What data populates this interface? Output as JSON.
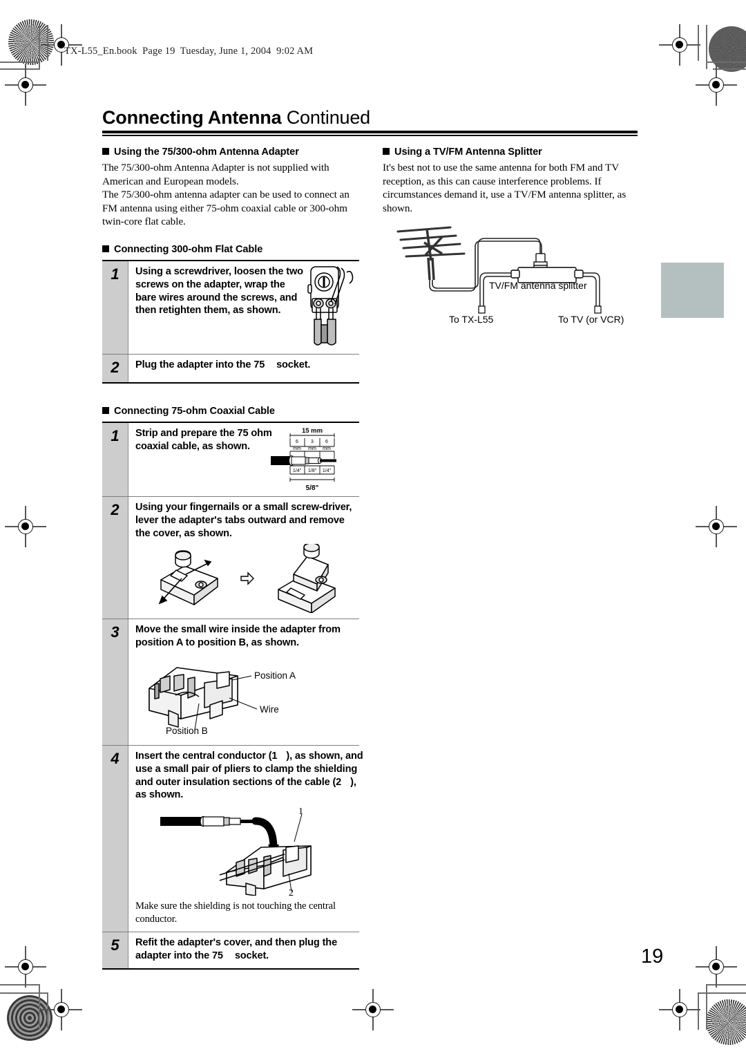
{
  "header": {
    "book_line": "TX-L55_En.book  Page 19  Tuesday, June 1, 2004  9:02 AM"
  },
  "title": {
    "main": "Connecting Antenna",
    "continued": "Continued"
  },
  "page_number": "19",
  "left_column": {
    "section1": {
      "heading": "Using the 75/300-ohm Antenna Adapter",
      "paragraphs": [
        "The 75/300-ohm Antenna Adapter is not supplied with American and European models.",
        "The 75/300-ohm antenna adapter can be used to connect an FM antenna using either 75-ohm coaxial cable or 300-ohm twin-core flat cable."
      ]
    },
    "section2": {
      "heading": "Connecting 300-ohm Flat Cable",
      "steps": [
        {
          "number": "1",
          "text": "Using a screwdriver, loosen the two screws on the adapter, wrap the bare wires around the screws, and then retighten them, as shown.",
          "figure": "adapter-screws-screwdriver-illustration"
        },
        {
          "number": "2",
          "text_before": "Plug the adapter into the 75",
          "text_after": "socket.",
          "figure": null
        }
      ]
    },
    "section3": {
      "heading": "Connecting 75-ohm Coaxial Cable",
      "steps": [
        {
          "number": "1",
          "text": "Strip and prepare the 75 ohm coaxial cable, as shown.",
          "figure": "coaxial-cable-dimensions-illustration",
          "figure_labels": {
            "total_mm": "15 mm",
            "seg1_val": "6",
            "seg1_unit": "mm",
            "seg2_val": "3",
            "seg2_unit": "mm",
            "seg3_val": "6",
            "seg3_unit": "mm",
            "seg1_in": "1/4\"",
            "seg2_in": "1/8\"",
            "seg3_in": "1/4\"",
            "total_in": "5/8\""
          }
        },
        {
          "number": "2",
          "text": "Using your fingernails or a small screw-driver, lever the adapter's tabs outward and remove the cover, as shown.",
          "figure": "adapter-cover-removal-illustration"
        },
        {
          "number": "3",
          "text": "Move the small wire inside the adapter from position A to position B, as shown.",
          "figure": "adapter-wire-position-illustration",
          "figure_labels": {
            "position_a": "Position A",
            "wire": "Wire",
            "position_b": "Position B"
          }
        },
        {
          "number": "4",
          "text_p1": "Insert the central conductor (1",
          "text_p2": "), as shown, and use a small pair of pliers to clamp the shielding and outer insulation sections of the cable (2",
          "text_p3": "), as shown.",
          "figure": "cable-insertion-illustration",
          "figure_labels": {
            "one": "1",
            "two": "2"
          },
          "note": "Make sure the shielding is not touching the central conductor."
        },
        {
          "number": "5",
          "text_before": "Refit the adapter's cover, and then plug the adapter into the 75",
          "text_after": "socket.",
          "figure": null
        }
      ]
    }
  },
  "right_column": {
    "section1": {
      "heading": "Using a TV/FM Antenna Splitter",
      "paragraphs": [
        "It's best not to use the same antenna for both FM and TV reception, as this can cause interference problems. If circumstances demand it, use a TV/FM antenna splitter, as shown."
      ],
      "diagram": {
        "name": "tv-fm-antenna-splitter-diagram",
        "labels": {
          "splitter": "TV/FM antenna splitter",
          "to_receiver": "To TX-L55",
          "to_tv": "To TV (or VCR)"
        }
      }
    }
  },
  "colors": {
    "step_number_bg": "#cdcdcd",
    "tab_marker": "#b4c0c0",
    "rule": "#000000"
  }
}
